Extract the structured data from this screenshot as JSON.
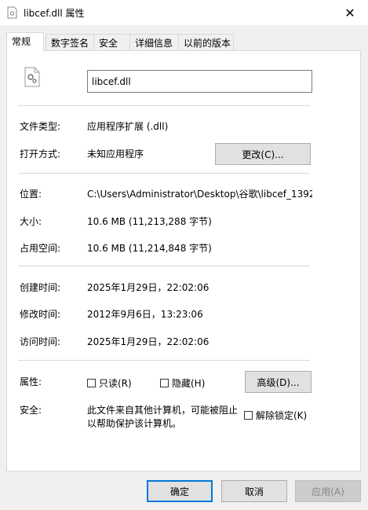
{
  "window": {
    "title": "libcef.dll 属性",
    "close_glyph": "✕"
  },
  "tabs": [
    {
      "label": "常规"
    },
    {
      "label": "数字签名"
    },
    {
      "label": "安全"
    },
    {
      "label": "详细信息"
    },
    {
      "label": "以前的版本"
    }
  ],
  "file": {
    "name": "libcef.dll"
  },
  "info": {
    "type_label": "文件类型:",
    "type_value": "应用程序扩展 (.dll)",
    "opens_label": "打开方式:",
    "opens_value": "未知应用程序",
    "change_button": "更改(C)...",
    "location_label": "位置:",
    "location_value": "C:\\Users\\Administrator\\Desktop\\谷歌\\libcef_1392",
    "size_label": "大小:",
    "size_value": "10.6 MB (11,213,288 字节)",
    "disk_label": "占用空间:",
    "disk_value": "10.6 MB (11,214,848 字节)",
    "created_label": "创建时间:",
    "created_value": "2025年1月29日，22:02:06",
    "modified_label": "修改时间:",
    "modified_value": "2012年9月6日，13:23:06",
    "accessed_label": "访问时间:",
    "accessed_value": "2025年1月29日，22:02:06",
    "attributes_label": "属性:",
    "readonly_label": "只读(R)",
    "hidden_label": "隐藏(H)",
    "advanced_button": "高级(D)...",
    "security_label": "安全:",
    "security_line1": "此文件来自其他计算机，可能被阻止",
    "security_line2": "以帮助保护该计算机。",
    "unblock_label": "解除锁定(K)"
  },
  "buttons": {
    "ok": "确定",
    "cancel": "取消",
    "apply": "应用(A)"
  },
  "colors": {
    "accent": "#0078d7"
  }
}
